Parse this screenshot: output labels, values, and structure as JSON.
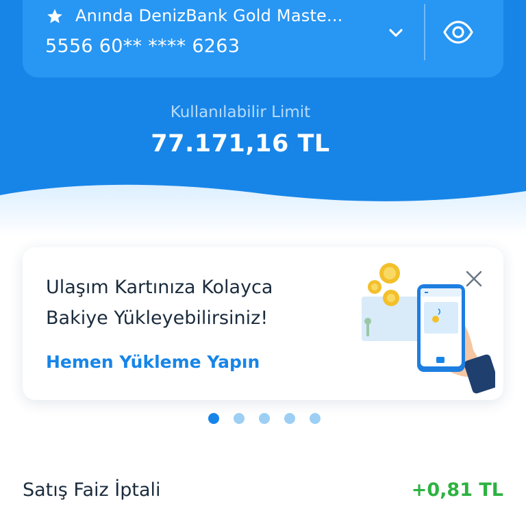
{
  "card": {
    "name": "Anında DenizBank Gold Maste...",
    "number": "5556 60** **** 6263"
  },
  "limit": {
    "label": "Kullanılabilir Limit",
    "value": "77.171,16 TL"
  },
  "promo": {
    "title": "Ulaşım Kartınıza Kolayca Bakiye Yükleyebilirsiniz!",
    "link": "Hemen Yükleme Yapın"
  },
  "carousel": {
    "total_pages": 5,
    "active_page": 1
  },
  "transaction": {
    "title": "Satış Faiz İptali",
    "amount": "+0,81 TL"
  },
  "colors": {
    "primary_blue": "#1785e8",
    "card_blue": "#2896f3",
    "positive_green": "#2db240"
  },
  "icons": [
    "star-icon",
    "chevron-down-icon",
    "eye-icon",
    "close-icon"
  ]
}
